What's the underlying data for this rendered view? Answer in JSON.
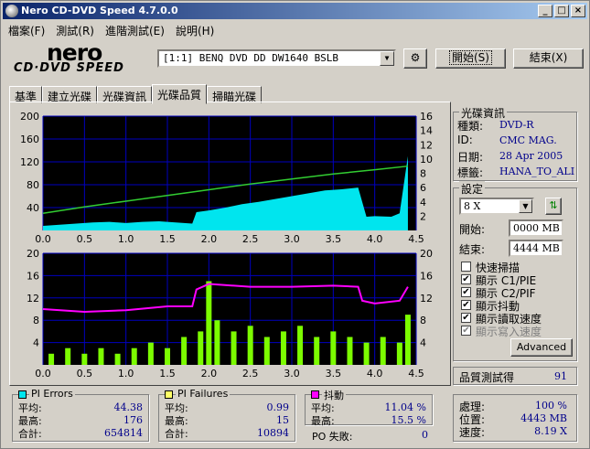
{
  "window": {
    "title": "Nero CD-DVD Speed 4.7.0.0"
  },
  "menu": [
    "檔案(F)",
    "測試(R)",
    "進階測試(E)",
    "說明(H)"
  ],
  "logo": {
    "brand": "nero",
    "subtitle": "CD·DVD SPEED"
  },
  "drive": {
    "selected": "[1:1]   BENQ DVD DD DW1640 BSLB"
  },
  "buttons": {
    "start": "開始(S)",
    "exit": "結束(X)",
    "advanced": "Advanced"
  },
  "tabs": [
    "基準",
    "建立光碟",
    "光碟資訊",
    "光碟品質",
    "掃瞄光碟"
  ],
  "active_tab": "光碟品質",
  "chart_data": [
    {
      "type": "area",
      "title": "",
      "x_ticks": [
        "0.0",
        "0.5",
        "1.0",
        "1.5",
        "2.0",
        "2.5",
        "3.0",
        "3.5",
        "4.0",
        "4.5"
      ],
      "y_left_ticks": [
        "200",
        "160",
        "120",
        "80",
        "40"
      ],
      "y_right_ticks": [
        "16",
        "14",
        "12",
        "10",
        "8",
        "6",
        "4",
        "2"
      ],
      "xlim": [
        0,
        4.5
      ],
      "ylim_left": [
        0,
        200
      ],
      "ylim_right": [
        0,
        16
      ],
      "series": [
        {
          "name": "PI Errors",
          "color": "#00e5ee",
          "x": [
            0.0,
            0.2,
            0.4,
            0.6,
            0.8,
            1.0,
            1.2,
            1.4,
            1.6,
            1.8,
            1.85,
            2.0,
            2.2,
            2.4,
            2.6,
            2.8,
            3.0,
            3.2,
            3.4,
            3.6,
            3.8,
            3.9,
            4.0,
            4.2,
            4.3,
            4.4
          ],
          "y": [
            8,
            10,
            12,
            14,
            15,
            13,
            15,
            16,
            14,
            12,
            32,
            35,
            40,
            46,
            50,
            55,
            60,
            65,
            70,
            72,
            75,
            24,
            25,
            24,
            30,
            130
          ]
        },
        {
          "name": "讀取速度",
          "color": "#32cd32",
          "x": [
            0.0,
            0.5,
            1.0,
            1.5,
            2.0,
            2.5,
            3.0,
            3.5,
            4.0,
            4.4
          ],
          "y": [
            2.4,
            3.3,
            4.1,
            4.9,
            5.7,
            6.5,
            7.2,
            7.9,
            8.5,
            9.0
          ]
        }
      ]
    },
    {
      "type": "bar",
      "x_ticks": [
        "0.0",
        "0.5",
        "1.0",
        "1.5",
        "2.0",
        "2.5",
        "3.0",
        "3.5",
        "4.0",
        "4.5"
      ],
      "y_left_ticks": [
        "20",
        "16",
        "12",
        "8",
        "4"
      ],
      "y_right_ticks": [
        "20",
        "16",
        "12",
        "8",
        "4"
      ],
      "xlim": [
        0,
        4.5
      ],
      "ylim_left": [
        0,
        20
      ],
      "ylim_right": [
        0,
        20
      ],
      "series": [
        {
          "name": "PI Failures",
          "color": "#7cfc00",
          "x": [
            0.1,
            0.3,
            0.5,
            0.7,
            0.9,
            1.1,
            1.3,
            1.5,
            1.7,
            1.9,
            2.0,
            2.1,
            2.3,
            2.5,
            2.7,
            2.9,
            3.1,
            3.3,
            3.5,
            3.7,
            3.9,
            4.1,
            4.3,
            4.4
          ],
          "y": [
            2,
            3,
            2,
            3,
            2,
            3,
            4,
            3,
            5,
            6,
            15,
            8,
            6,
            7,
            5,
            6,
            7,
            5,
            6,
            5,
            4,
            5,
            4,
            9
          ]
        },
        {
          "name": "抖動",
          "color": "#ff00ff",
          "x": [
            0.0,
            0.5,
            1.0,
            1.5,
            1.8,
            1.85,
            2.0,
            2.5,
            3.0,
            3.5,
            3.8,
            3.85,
            4.0,
            4.3,
            4.4
          ],
          "y": [
            10.0,
            9.5,
            9.8,
            10.5,
            10.5,
            13.5,
            14.5,
            14.0,
            14.0,
            14.2,
            14.0,
            11.5,
            11.0,
            11.5,
            14.0
          ]
        }
      ]
    }
  ],
  "disc_info": {
    "title": "光碟資訊",
    "rows": [
      {
        "label": "種類:",
        "value": "DVD-R"
      },
      {
        "label": "ID:",
        "value": "CMC MAG."
      },
      {
        "label": "日期:",
        "value": "28 Apr 2005"
      },
      {
        "label": "標籤:",
        "value": "HANA_TO_ALIC"
      }
    ]
  },
  "settings": {
    "title": "設定",
    "speed": "8 X",
    "start_label": "開始:",
    "start_value": "0000 MB",
    "end_label": "結束:",
    "end_value": "4444 MB",
    "checkboxes": [
      {
        "label": "快速掃描",
        "checked": false,
        "disabled": false
      },
      {
        "label": "顯示 C1/PIE",
        "checked": true,
        "disabled": false
      },
      {
        "label": "顯示 C2/PIF",
        "checked": true,
        "disabled": false
      },
      {
        "label": "顯示抖動",
        "checked": true,
        "disabled": false
      },
      {
        "label": "顯示讀取速度",
        "checked": true,
        "disabled": false
      },
      {
        "label": "顯示寫入速度",
        "checked": true,
        "disabled": true
      }
    ]
  },
  "quality": {
    "label": "品質測試得",
    "value": "91"
  },
  "progress": {
    "rows": [
      {
        "label": "處理:",
        "value": "100 %"
      },
      {
        "label": "位置:",
        "value": "4443 MB"
      },
      {
        "label": "速度:",
        "value": "8.19 X"
      }
    ]
  },
  "stats": {
    "pi_errors": {
      "title": "PI Errors",
      "color": "#00e5ee",
      "avg_label": "平均:",
      "avg": "44.38",
      "max_label": "最高:",
      "max": "176",
      "total_label": "合計:",
      "total": "654814"
    },
    "pi_failures": {
      "title": "PI Failures",
      "color": "#ffff66",
      "avg_label": "平均:",
      "avg": "0.99",
      "max_label": "最高:",
      "max": "15",
      "total_label": "合計:",
      "total": "10894"
    },
    "jitter": {
      "title": "抖動",
      "color": "#ff00ff",
      "avg_label": "平均:",
      "avg": "11.04 %",
      "max_label": "最高:",
      "max": "15.5 %"
    },
    "po_failures": {
      "label": "PO 失敗:",
      "value": "0"
    }
  },
  "colors": {
    "chart_bg": "#000000",
    "grid": "#0000c0",
    "title_bar": "#0a246a"
  }
}
